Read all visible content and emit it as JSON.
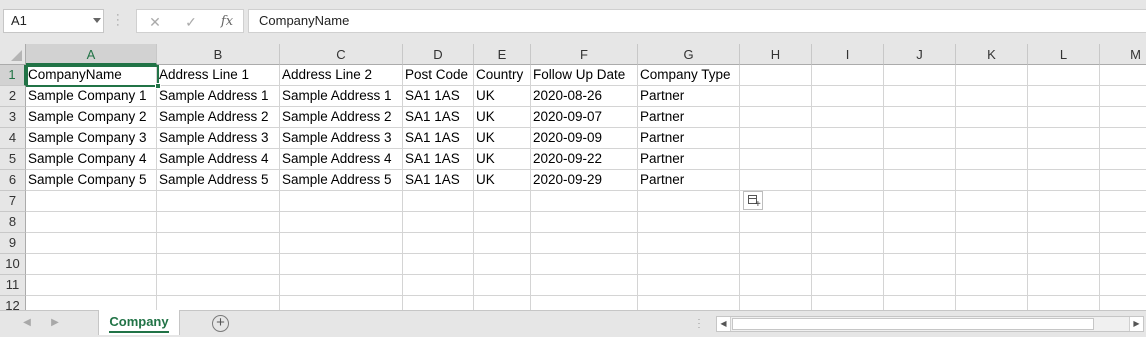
{
  "formula_bar": {
    "name_box": "A1",
    "fx_symbol": "fx",
    "cancel_symbol": "✕",
    "enter_symbol": "✓",
    "formula": "CompanyName"
  },
  "sheet": {
    "active_cell": "A1",
    "columns": [
      "A",
      "B",
      "C",
      "D",
      "E",
      "F",
      "G",
      "H",
      "I",
      "J",
      "K",
      "L",
      "M"
    ],
    "row_numbers": [
      "1",
      "2",
      "3",
      "4",
      "5",
      "6",
      "7",
      "8",
      "9",
      "10",
      "11",
      "12"
    ],
    "rows": [
      [
        "CompanyName",
        "Address Line 1",
        "Address Line 2",
        "Post Code",
        "Country",
        "Follow Up Date",
        "Company Type"
      ],
      [
        "Sample Company 1",
        "Sample Address 1",
        "Sample Address 1",
        "SA1 1AS",
        "UK",
        "2020-08-26",
        "Partner"
      ],
      [
        "Sample Company 2",
        "Sample Address 2",
        "Sample Address 2",
        "SA1 1AS",
        "UK",
        "2020-09-07",
        "Partner"
      ],
      [
        "Sample Company 3",
        "Sample Address 3",
        "Sample Address 3",
        "SA1 1AS",
        "UK",
        "2020-09-09",
        "Partner"
      ],
      [
        "Sample Company 4",
        "Sample Address 4",
        "Sample Address 4",
        "SA1 1AS",
        "UK",
        "2020-09-22",
        "Partner"
      ],
      [
        "Sample Company 5",
        "Sample Address 5",
        "Sample Address 5",
        "SA1 1AS",
        "UK",
        "2020-09-29",
        "Partner"
      ]
    ]
  },
  "tabs": {
    "sheets": [
      "Company"
    ],
    "active": "Company",
    "add_symbol": "+"
  },
  "colors": {
    "accent": "#217346",
    "header_bg": "#e6e6e6",
    "gridline": "#d4d4d4"
  },
  "icons": {
    "name_box_dropdown": "chevron-down-icon",
    "cancel": "close-icon",
    "enter": "check-icon",
    "insert_function": "fx-icon",
    "quick_analysis": "quick-analysis-icon",
    "add_sheet": "plus-circle-icon"
  }
}
